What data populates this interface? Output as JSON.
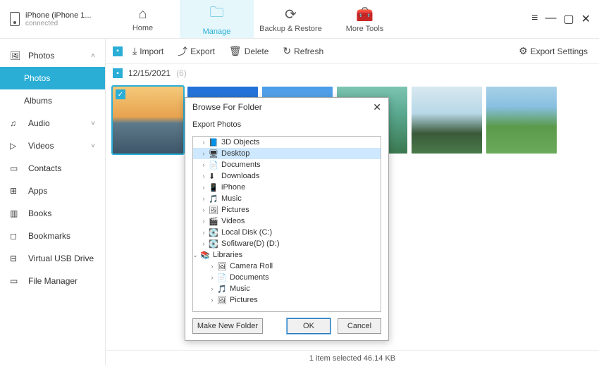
{
  "device": {
    "name": "iPhone (iPhone 1...",
    "status": "connected"
  },
  "nav": {
    "home": "Home",
    "manage": "Manage",
    "backup": "Backup & Restore",
    "more": "More Tools"
  },
  "sidebar": {
    "photos": "Photos",
    "photos_sub": "Photos",
    "albums": "Albums",
    "audio": "Audio",
    "videos": "Videos",
    "contacts": "Contacts",
    "apps": "Apps",
    "books": "Books",
    "bookmarks": "Bookmarks",
    "vusb": "Virtual USB Drive",
    "fm": "File Manager"
  },
  "toolbar": {
    "import": "Import",
    "export": "Export",
    "delete": "Delete",
    "refresh": "Refresh",
    "exportSettings": "Export Settings"
  },
  "date": {
    "value": "12/15/2021",
    "count": "(6)"
  },
  "status": "1 item selected 46.14 KB",
  "dialog": {
    "title": "Browse For Folder",
    "subtitle": "Export Photos",
    "items": [
      {
        "label": "3D Objects",
        "icon": "📘"
      },
      {
        "label": "Desktop",
        "icon": "🖥",
        "selected": true
      },
      {
        "label": "Documents",
        "icon": "📄"
      },
      {
        "label": "Downloads",
        "icon": "⬇"
      },
      {
        "label": "iPhone",
        "icon": "📱"
      },
      {
        "label": "Music",
        "icon": "🎵"
      },
      {
        "label": "Pictures",
        "icon": "🖼"
      },
      {
        "label": "Videos",
        "icon": "🎬"
      },
      {
        "label": "Local Disk (C:)",
        "icon": "💽"
      },
      {
        "label": "Sofitware(D) (D:)",
        "icon": "💽"
      }
    ],
    "lib": "Libraries",
    "libItems": [
      {
        "label": "Camera Roll",
        "icon": "🖼"
      },
      {
        "label": "Documents",
        "icon": "📄"
      },
      {
        "label": "Music",
        "icon": "🎵"
      },
      {
        "label": "Pictures",
        "icon": "🖼"
      }
    ],
    "make": "Make New Folder",
    "ok": "OK",
    "cancel": "Cancel"
  }
}
